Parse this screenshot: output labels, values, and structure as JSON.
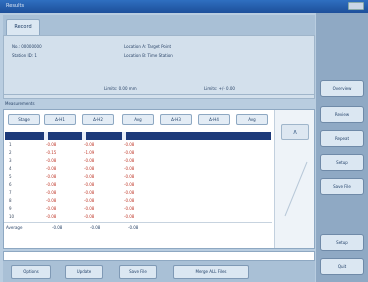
{
  "window": {
    "title": "Results",
    "controls_label": ""
  },
  "tabs": [
    {
      "label": "Record"
    }
  ],
  "info": {
    "row1_left": "No.: 00000000",
    "row1_right": "Location A: Target Point",
    "row2_left": "Station ID: 1",
    "row2_right": "Location B: Time Station",
    "row3_left": "Limits: 0.00 mm",
    "row3_right": "Limits: +/- 0.00"
  },
  "section_label": "Measurements",
  "columns": [
    "Stage",
    "Δ-H1",
    "Δ-H2",
    "Avg",
    "Δ-H3",
    "Δ-H4",
    "Avg"
  ],
  "rows": [
    {
      "idx": "1",
      "a": "-0.08",
      "b": "-0.08",
      "c": "-0.08"
    },
    {
      "idx": "2",
      "a": "-0.15",
      "b": "-1.09",
      "c": "-0.08"
    },
    {
      "idx": "3",
      "a": "-0.08",
      "b": "-0.08",
      "c": "-0.08"
    },
    {
      "idx": "4",
      "a": "-0.08",
      "b": "-0.08",
      "c": "-0.08"
    },
    {
      "idx": "5",
      "a": "-0.08",
      "b": "-0.08",
      "c": "-0.08"
    },
    {
      "idx": "6",
      "a": "-0.08",
      "b": "-0.08",
      "c": "-0.08"
    },
    {
      "idx": "7",
      "a": "-0.08",
      "b": "-0.08",
      "c": "-0.08"
    },
    {
      "idx": "8",
      "a": "-0.08",
      "b": "-0.08",
      "c": "-0.08"
    },
    {
      "idx": "9",
      "a": "-0.08",
      "b": "-0.08",
      "c": "-0.08"
    },
    {
      "idx": "10",
      "a": "-0.08",
      "b": "-0.08",
      "c": "-0.08"
    }
  ],
  "average": {
    "label": "Average",
    "a": "-0.08",
    "b": "-0.08",
    "c": "-0.08"
  },
  "scroll": {
    "up": "∧",
    "down": "∨"
  },
  "bottom_buttons": [
    "Options",
    "Update",
    "Save File",
    "Merge ALL Files"
  ],
  "sidebar_buttons": [
    "Overview",
    "Review",
    "Repeat",
    "Setup",
    "Save File",
    "Setup",
    "Quit"
  ]
}
